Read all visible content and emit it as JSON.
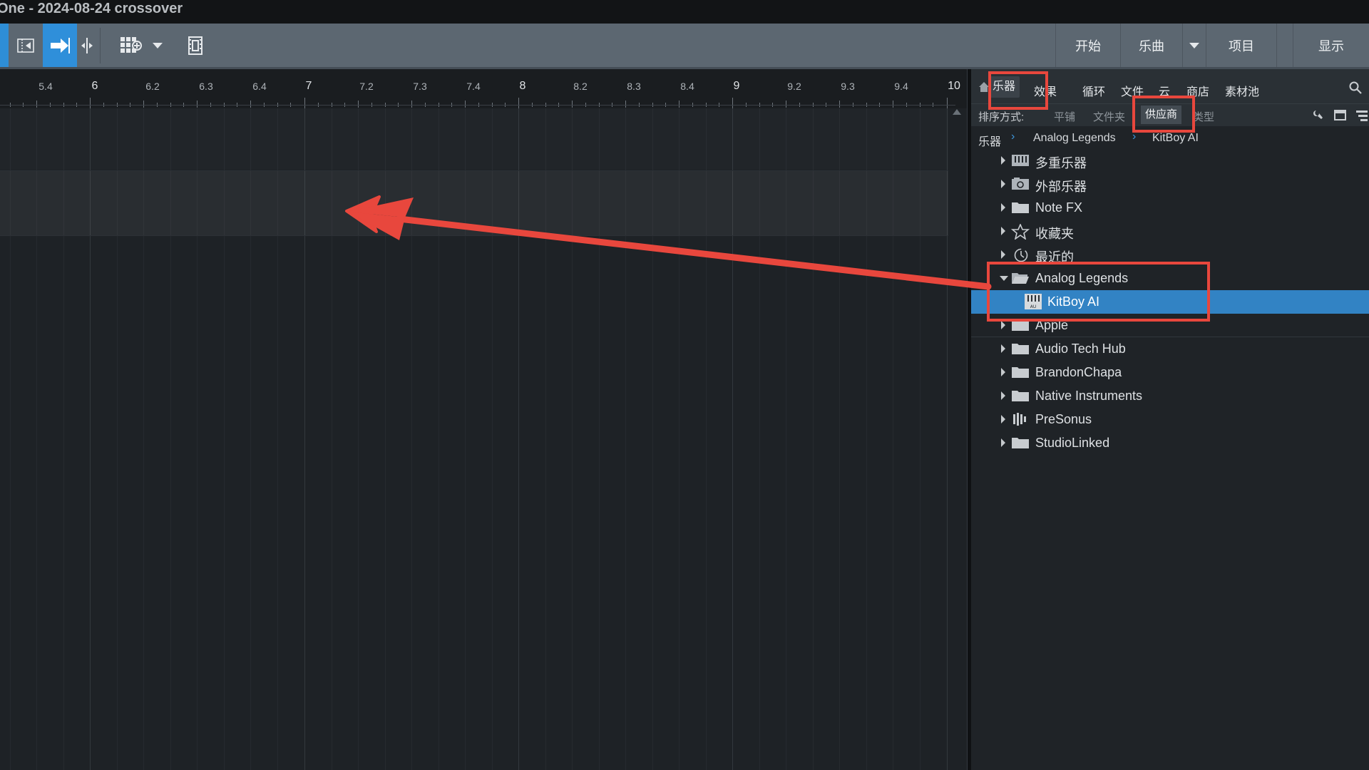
{
  "window": {
    "title": "One - 2024-08-24 crossover"
  },
  "toolbar": {
    "icons": [
      "split-icon",
      "arrow-right-icon",
      "split-cursor-icon",
      "grid-add-icon",
      "chevron-down-icon",
      "film-icon"
    ],
    "tabs": {
      "start": "开始",
      "song": "乐曲",
      "project": "项目",
      "show": "显示"
    }
  },
  "ruler": {
    "labels": [
      {
        "text": "5.4",
        "major": false
      },
      {
        "text": "6",
        "major": true
      },
      {
        "text": "6.2",
        "major": false
      },
      {
        "text": "6.3",
        "major": false
      },
      {
        "text": "6.4",
        "major": false
      },
      {
        "text": "7",
        "major": true
      },
      {
        "text": "7.2",
        "major": false
      },
      {
        "text": "7.3",
        "major": false
      },
      {
        "text": "7.4",
        "major": false
      },
      {
        "text": "8",
        "major": true
      },
      {
        "text": "8.2",
        "major": false
      },
      {
        "text": "8.3",
        "major": false
      },
      {
        "text": "8.4",
        "major": false
      },
      {
        "text": "9",
        "major": true
      },
      {
        "text": "9.2",
        "major": false
      },
      {
        "text": "9.3",
        "major": false
      },
      {
        "text": "9.4",
        "major": false
      },
      {
        "text": "10",
        "major": true
      }
    ]
  },
  "browser": {
    "tabs": [
      "乐器",
      "效果",
      "循环",
      "文件",
      "云",
      "商店",
      "素材池"
    ],
    "active_tab": "乐器",
    "sort": {
      "label": "排序方式:",
      "options": [
        "平铺",
        "文件夹",
        "供应商",
        "类型"
      ],
      "active": "供应商"
    },
    "breadcrumb": [
      "乐器",
      "Analog Legends",
      "KitBoy AI"
    ],
    "tree": [
      {
        "label": "多重乐器",
        "icon": "multi-instrument-icon",
        "expanded": false
      },
      {
        "label": "外部乐器",
        "icon": "external-instrument-icon",
        "expanded": false
      },
      {
        "label": "Note FX",
        "icon": "folder-icon",
        "expanded": false
      },
      {
        "label": "收藏夹",
        "icon": "star-icon",
        "expanded": false
      },
      {
        "label": "最近的",
        "icon": "clock-icon",
        "expanded": false
      },
      {
        "label": "Analog Legends",
        "icon": "folder-open-icon",
        "expanded": true
      },
      {
        "label": "KitBoy AI",
        "icon": "au-plugin-icon",
        "child": true,
        "selected": true
      },
      {
        "label": "Apple",
        "icon": "folder-icon",
        "expanded": false
      },
      {
        "label": "Audio Tech Hub",
        "icon": "folder-icon",
        "expanded": false
      },
      {
        "label": "BrandonChapa",
        "icon": "folder-icon",
        "expanded": false
      },
      {
        "label": "Native Instruments",
        "icon": "folder-icon",
        "expanded": false
      },
      {
        "label": "PreSonus",
        "icon": "presonus-icon",
        "expanded": false
      },
      {
        "label": "StudioLinked",
        "icon": "folder-icon",
        "expanded": false
      }
    ]
  },
  "colors": {
    "accent": "#2f8fda",
    "selection": "#3283c4",
    "annotation": "#e8473d"
  }
}
